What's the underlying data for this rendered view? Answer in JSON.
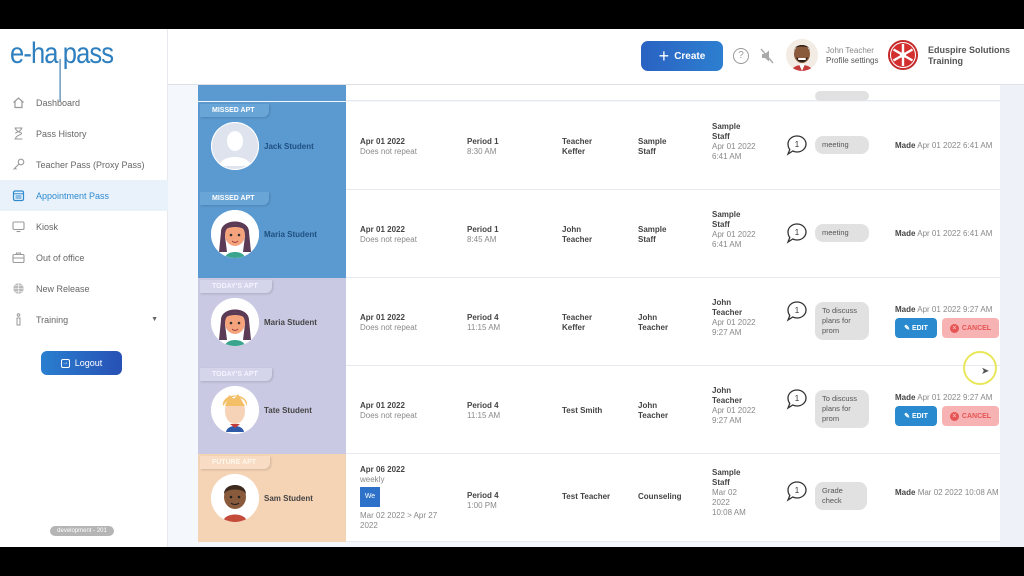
{
  "app": {
    "logo_text": "e-hallpass"
  },
  "sidebar": {
    "items": [
      {
        "label": "Dashboard",
        "icon": "home-icon"
      },
      {
        "label": "Pass History",
        "icon": "hourglass-icon"
      },
      {
        "label": "Teacher Pass (Proxy Pass)",
        "icon": "key-icon"
      },
      {
        "label": "Appointment Pass",
        "icon": "calendar-icon",
        "active": true
      },
      {
        "label": "Kiosk",
        "icon": "monitor-icon"
      },
      {
        "label": "Out of office",
        "icon": "briefcase-icon"
      },
      {
        "label": "New Release",
        "icon": "globe-icon"
      },
      {
        "label": "Training",
        "icon": "training-icon",
        "has_dropdown": true
      }
    ],
    "logout_label": "Logout",
    "env_badge": "development - 201"
  },
  "header": {
    "create_label": "Create",
    "help_icon": "?",
    "user_name": "John Teacher",
    "user_sub": "Profile settings",
    "school_name": "Eduspire Solutions",
    "school_sub": "Training"
  },
  "appointments": [
    {
      "status": "MISSED APT",
      "type": "missed",
      "student": "Jack Student",
      "avatar": "placeholder",
      "date": "Apr 01 2022",
      "repeat": "Does not repeat",
      "period": "Period 1",
      "time": "8:30 AM",
      "teacher": [
        "Teacher",
        "Keffer"
      ],
      "staff": [
        "Sample",
        "Staff"
      ],
      "created_by": [
        "Sample",
        "Staff"
      ],
      "created_at": [
        "Apr 01 2022",
        "6:41 AM"
      ],
      "comments": "1",
      "note": "meeting",
      "made_label": "Made",
      "made": "Apr 01 2022 6:41 AM",
      "actions": false
    },
    {
      "status": "MISSED APT",
      "type": "missed",
      "student": "Maria Student",
      "avatar": "girl",
      "date": "Apr 01 2022",
      "repeat": "Does not repeat",
      "period": "Period 1",
      "time": "8:45 AM",
      "teacher": [
        "John",
        "Teacher"
      ],
      "staff": [
        "Sample",
        "Staff"
      ],
      "created_by": [
        "Sample",
        "Staff"
      ],
      "created_at": [
        "Apr 01 2022",
        "6:41 AM"
      ],
      "comments": "1",
      "note": "meeting",
      "made_label": "Made",
      "made": "Apr 01 2022 6:41 AM",
      "actions": false
    },
    {
      "status": "TODAY'S APT",
      "type": "today",
      "student": "Maria Student",
      "avatar": "girl",
      "date": "Apr 01 2022",
      "repeat": "Does not repeat",
      "period": "Period 4",
      "time": "11:15 AM",
      "teacher": [
        "Teacher",
        "Keffer"
      ],
      "staff": [
        "John",
        "Teacher"
      ],
      "created_by": [
        "John",
        "Teacher"
      ],
      "created_at": [
        "Apr 01 2022",
        "9:27 AM"
      ],
      "comments": "1",
      "note": "To discuss plans for prom",
      "made_label": "Made",
      "made": "Apr 01 2022 9:27 AM",
      "actions": true
    },
    {
      "status": "TODAY'S APT",
      "type": "today",
      "student": "Tate Student",
      "avatar": "boy-blond",
      "date": "Apr 01 2022",
      "repeat": "Does not repeat",
      "period": "Period 4",
      "time": "11:15 AM",
      "teacher": [
        "Test Smith"
      ],
      "staff": [
        "John",
        "Teacher"
      ],
      "created_by": [
        "John",
        "Teacher"
      ],
      "created_at": [
        "Apr 01 2022",
        "9:27 AM"
      ],
      "comments": "1",
      "note": "To discuss plans for prom",
      "made_label": "Made",
      "made": "Apr 01 2022 9:27 AM",
      "actions": true
    },
    {
      "status": "FUTURE APT",
      "type": "future",
      "student": "Sam Student",
      "avatar": "boy-dark",
      "date": "Apr 06 2022",
      "repeat": "weekly",
      "day_chip": "We",
      "range": "Mar 02 2022 > Apr 27 2022",
      "period": "Period 4",
      "time": "1:00 PM",
      "teacher": [
        "Test Teacher"
      ],
      "staff": [
        "Counseling"
      ],
      "created_by": [
        "Sample",
        "Staff"
      ],
      "created_at": [
        "Mar 02 2022",
        "10:08 AM"
      ],
      "comments": "1",
      "note": "Grade check",
      "made_label": "Made",
      "made": "Mar 02 2022 10:08 AM",
      "actions": false
    }
  ],
  "actions": {
    "edit_label": "EDIT",
    "cancel_label": "CANCEL"
  }
}
